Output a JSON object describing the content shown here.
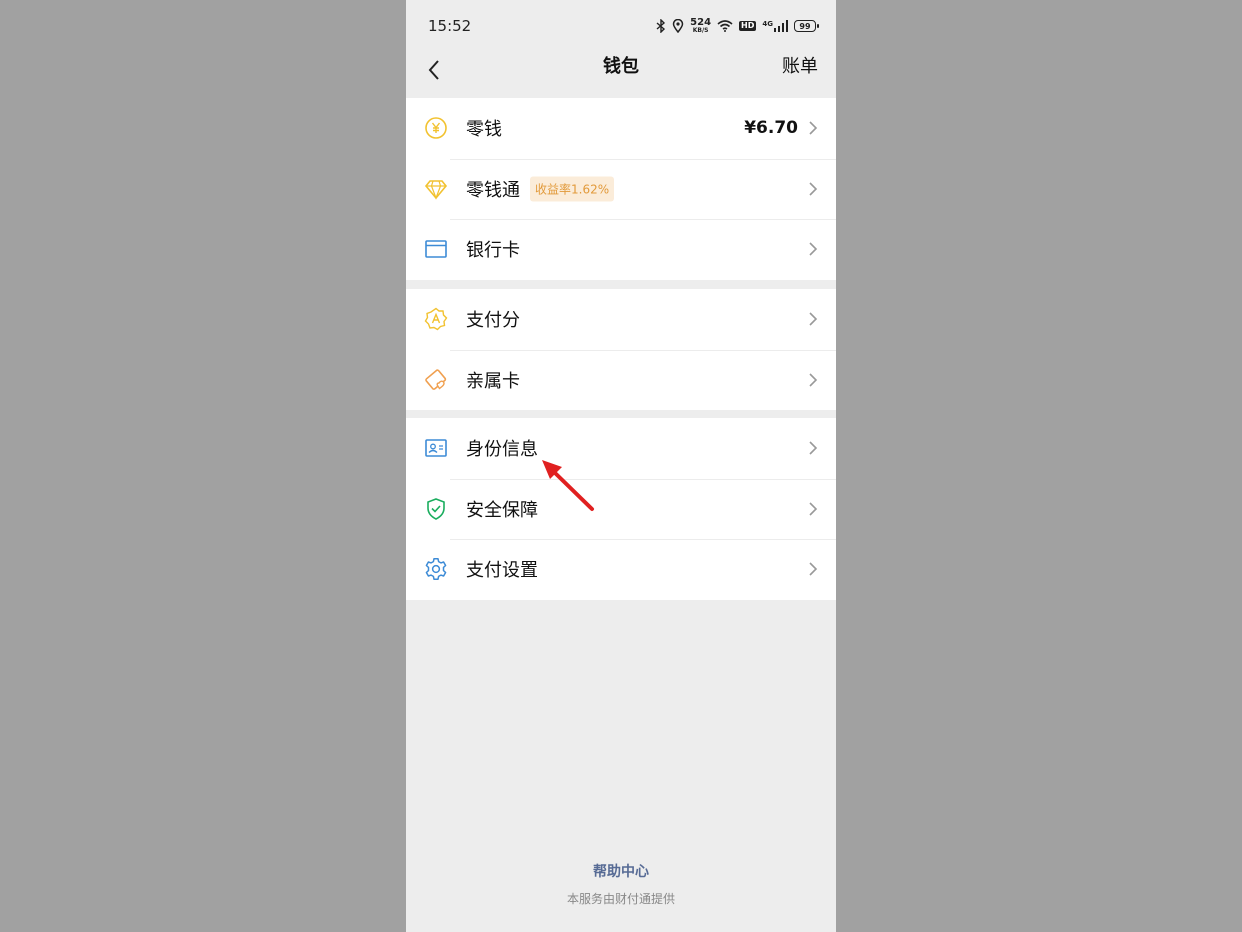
{
  "status_bar": {
    "time": "15:52",
    "net_speed": "524",
    "net_unit": "KB/S",
    "hd": "HD",
    "signal_type": "4G",
    "battery": "99"
  },
  "nav": {
    "title": "钱包",
    "right_link": "账单"
  },
  "groups": [
    {
      "items": [
        {
          "label": "零钱",
          "icon": "yuan-coin-icon",
          "value": "¥6.70"
        },
        {
          "label": "零钱通",
          "icon": "diamond-icon",
          "badge": "收益率1.62%"
        },
        {
          "label": "银行卡",
          "icon": "bank-card-icon"
        }
      ]
    },
    {
      "items": [
        {
          "label": "支付分",
          "icon": "pay-score-icon"
        },
        {
          "label": "亲属卡",
          "icon": "family-card-icon"
        }
      ]
    },
    {
      "items": [
        {
          "label": "身份信息",
          "icon": "id-card-icon"
        },
        {
          "label": "安全保障",
          "icon": "shield-check-icon"
        },
        {
          "label": "支付设置",
          "icon": "gear-icon"
        }
      ]
    }
  ],
  "footer": {
    "help": "帮助中心",
    "provider": "本服务由财付通提供"
  },
  "colors": {
    "page_bg": "#ededed",
    "yellow_icon": "#f2c230",
    "blue_icon": "#3d8bd6",
    "orange_icon": "#f0a050",
    "green_icon": "#1aad5e",
    "link_blue": "#576b95",
    "annotation_red": "#e02020"
  }
}
